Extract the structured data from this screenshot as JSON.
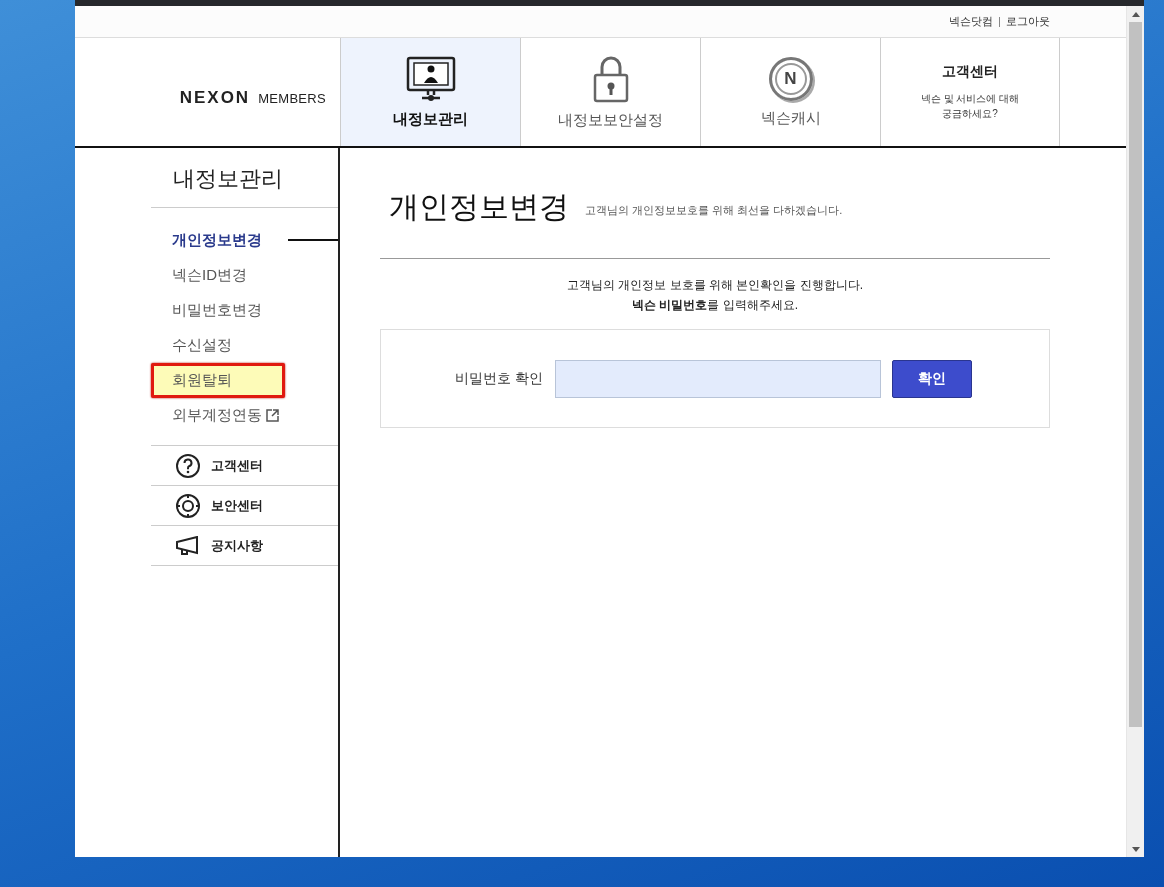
{
  "top_links": [
    "넥슨닷컴",
    "로그아웃"
  ],
  "logo": {
    "brand": "NEXON",
    "product": "MEMBERS"
  },
  "header_tabs": [
    {
      "kind": "monitor",
      "label": "내정보관리",
      "selected": true
    },
    {
      "kind": "lock",
      "label": "내정보보안설정",
      "selected": false
    },
    {
      "kind": "coin",
      "label": "넥슨캐시",
      "icon_text": "N",
      "selected": false
    },
    {
      "kind": "help",
      "label": "고객센터",
      "description": "넥슨 및 서비스에 대해 궁금하세요?",
      "selected": false
    }
  ],
  "sidebar": {
    "title": "내정보관리",
    "items": [
      {
        "label": "개인정보변경",
        "selected": true,
        "highlighted": false,
        "external": false
      },
      {
        "label": "넥슨ID변경",
        "selected": false,
        "highlighted": false,
        "external": false
      },
      {
        "label": "비밀번호변경",
        "selected": false,
        "highlighted": false,
        "external": false
      },
      {
        "label": "수신설정",
        "selected": false,
        "highlighted": false,
        "external": false
      },
      {
        "label": "회원탈퇴",
        "selected": false,
        "highlighted": true,
        "external": false
      },
      {
        "label": "외부계정연동",
        "selected": false,
        "highlighted": false,
        "external": true
      }
    ],
    "links": [
      {
        "kind": "help",
        "label": "고객센터"
      },
      {
        "kind": "security",
        "label": "보안센터"
      },
      {
        "kind": "notice",
        "label": "공지사항"
      }
    ]
  },
  "content": {
    "title": "개인정보변경",
    "subtitle": "고객님의 개인정보보호를 위해 최선을 다하겠습니다.",
    "message": [
      "고객님의 개인정보 보호를 위해 본인확인을 진행합니다.",
      "**넥슨 비밀번호**를 입력해주세요."
    ],
    "password_label": "비밀번호 확인",
    "confirm_button": "확인"
  }
}
